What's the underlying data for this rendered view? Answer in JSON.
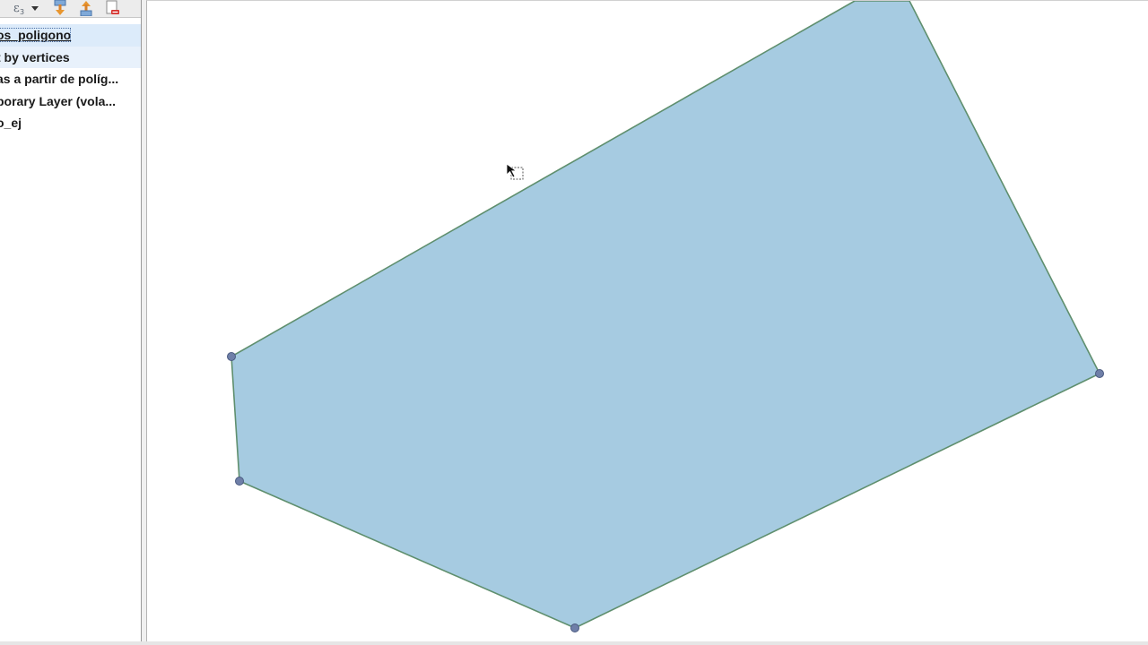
{
  "layers_panel": {
    "toolbar": {
      "icons": [
        "filter-expression-icon",
        "dropdown-arrow-icon",
        "expand-all-icon",
        "collapse-all-icon",
        "remove-layer-icon"
      ]
    },
    "layers": [
      {
        "label": "os_poligono",
        "state": "selected"
      },
      {
        "label": "t by vertices",
        "state": "hover"
      },
      {
        "label": "as a partir de políg...",
        "state": "normal"
      },
      {
        "label": "porary Layer (vola...",
        "state": "normal"
      },
      {
        "label": "o_ej",
        "state": "normal"
      }
    ]
  },
  "map": {
    "polygon": {
      "fill_color": "#a6cbe1",
      "stroke_color": "#5f8f6e",
      "vertex_color": "#6f7fa8"
    },
    "cursor": "select-feature-cursor-icon"
  }
}
